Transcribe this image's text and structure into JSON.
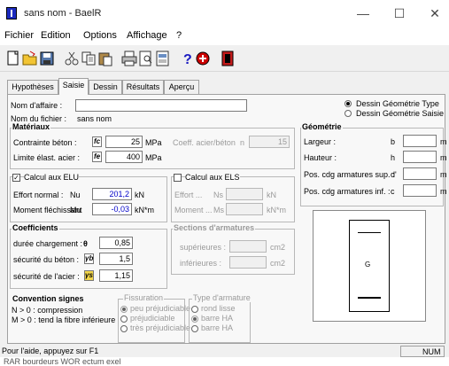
{
  "window": {
    "title": "sans nom - BaelR",
    "minimize": "—",
    "maximize": "☐",
    "close": "✕"
  },
  "menu": [
    "Fichier",
    "Edition",
    "Options",
    "Affichage",
    "?"
  ],
  "tabs": [
    "Hypothèses",
    "Saisie",
    "Dessin",
    "Résultats",
    "Aperçu"
  ],
  "form": {
    "affaire_label": "Nom d'affaire :",
    "affaire_value": "",
    "fichier_label": "Nom du fichier :",
    "fichier_value": "sans nom",
    "dessin_type": "Dessin Géométrie Type",
    "dessin_saisie": "Dessin Géométrie Saisie"
  },
  "materiaux": {
    "title": "Matériaux",
    "beton_label": "Contrainte béton :",
    "beton_sym": "fc",
    "beton_value": "25",
    "beton_unit": "MPa",
    "coeff_label": "Coeff. acier/béton",
    "coeff_sym": "n",
    "coeff_value": "15",
    "acier_label": "Limite élast. acier :",
    "acier_sym": "fe",
    "acier_value": "400",
    "acier_unit": "MPa"
  },
  "elu": {
    "title": "Calcul aux ELU",
    "effort_label": "Effort normal :",
    "effort_sym": "Nu",
    "effort_value": "201,2",
    "effort_unit": "kN",
    "moment_label": "Moment fléchissant",
    "moment_sym": "Mu",
    "moment_value": "-0,03",
    "moment_unit": "kN*m"
  },
  "els": {
    "title": "Calcul aux ELS",
    "effort_label": "Effort ...",
    "effort_sym": "Ns",
    "effort_unit": "kN",
    "moment_label": "Moment ...",
    "moment_sym": "Ms",
    "moment_unit": "kN*m"
  },
  "coefficients": {
    "title": "Coefficients",
    "duree_label": "durée chargement :",
    "duree_sym": "θ",
    "duree_value": "0,85",
    "sec_beton_label": "sécurité du béton :",
    "sec_beton_sym": "γb",
    "sec_beton_value": "1,5",
    "sec_acier_label": "sécurité de l'acier :",
    "sec_acier_sym": "γs",
    "sec_acier_value": "1,15"
  },
  "sections": {
    "title": "Sections d'armatures",
    "sup_label": "supérieures :",
    "sup_unit": "cm2",
    "inf_label": "inférieures :",
    "inf_unit": "cm2"
  },
  "geometrie": {
    "title": "Géométrie",
    "largeur_label": "Largeur :",
    "largeur_sym": "b",
    "hauteur_label": "Hauteur :",
    "hauteur_sym": "h",
    "cdg_sup_label": "Pos. cdg armatures sup. :",
    "cdg_sup_sym": "d'",
    "cdg_inf_label": "Pos. cdg armatures inf. :",
    "cdg_inf_sym": "c",
    "unit": "m",
    "drawing_label": "G"
  },
  "convention": {
    "title": "Convention signes",
    "line1": "N > 0 : compression",
    "line2": "M > 0 : tend la fibre inférieure"
  },
  "fissuration": {
    "title": "Fissuration",
    "opt1": "peu préjudiciable",
    "opt2": "préjudiciable",
    "opt3": "très préjudiciable"
  },
  "type_armature": {
    "title": "Type d'armature",
    "opt1": "rond lisse",
    "opt2": "barre HA",
    "opt3": "barre HA"
  },
  "status": {
    "help": "Pour l'aide, appuyez sur F1",
    "num": "NUM"
  },
  "taskbar": {
    "text": "RAR     bourdeurs WOR     ectum exel"
  },
  "colors": {
    "highlight_value": "#0000c8",
    "title_icon": "#1c2bbf"
  }
}
